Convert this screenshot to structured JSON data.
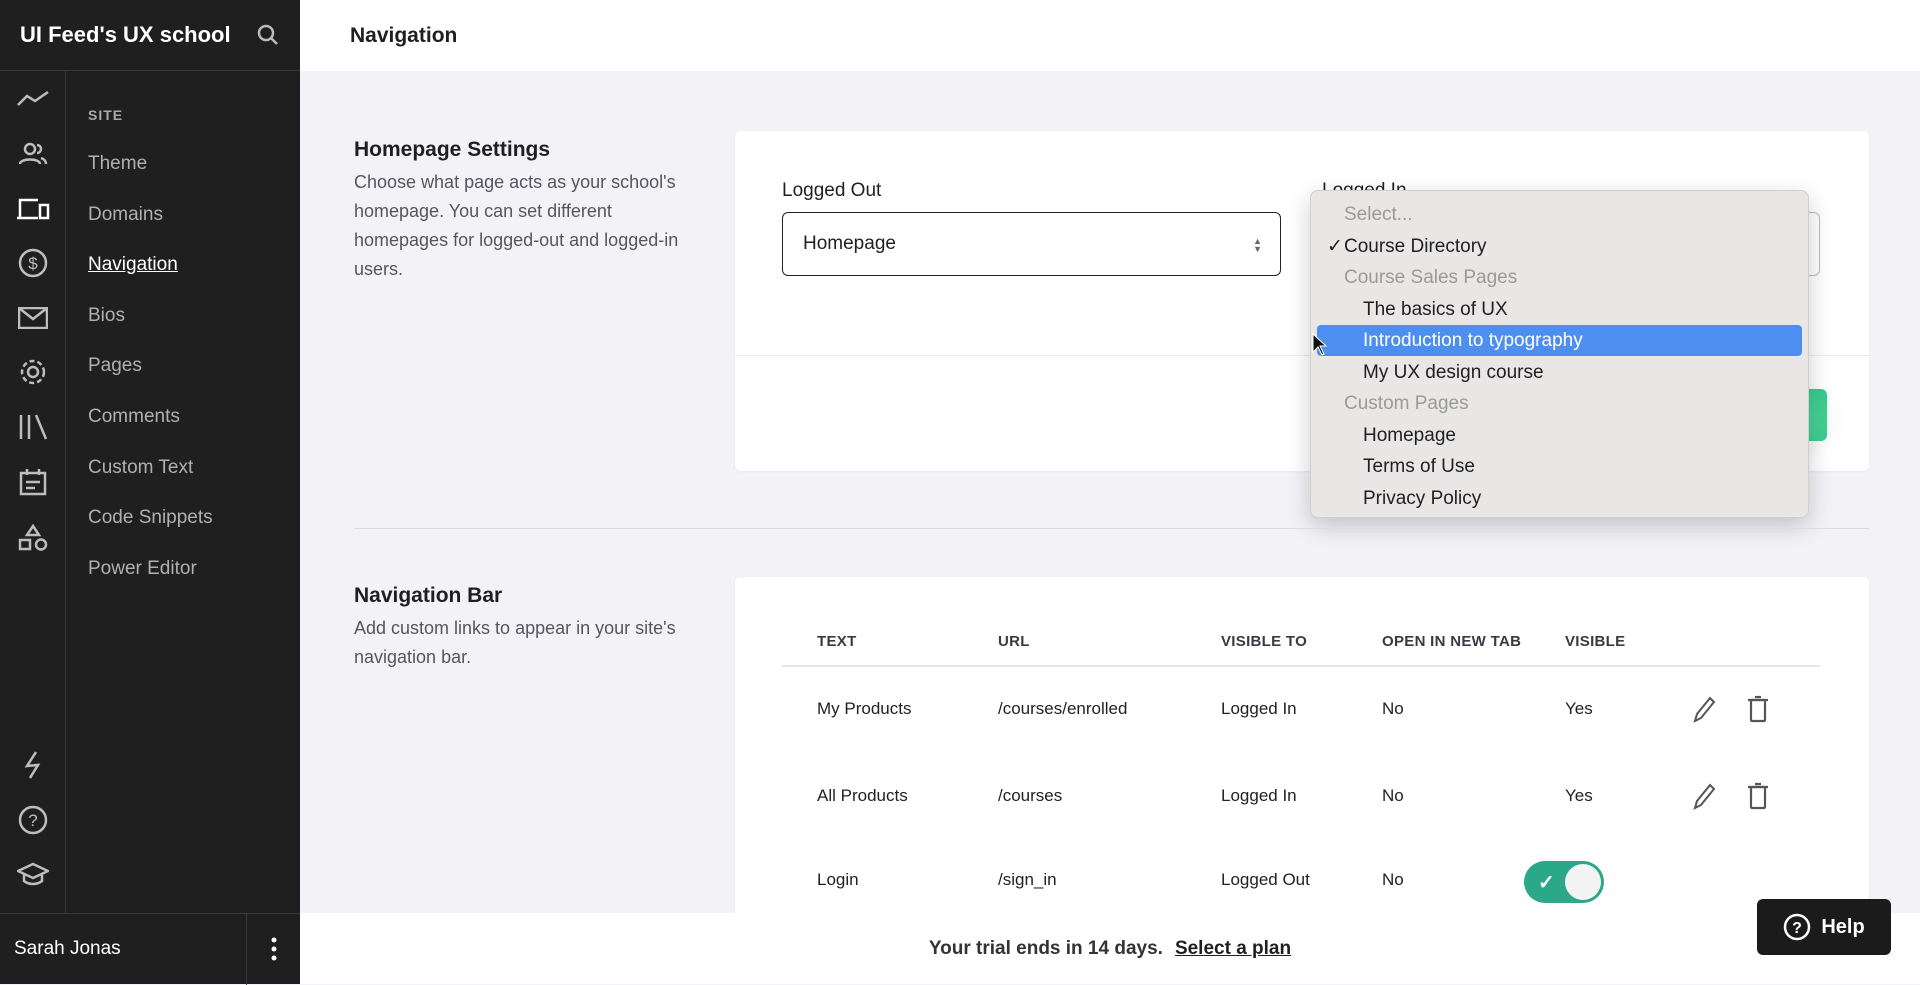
{
  "sidebar": {
    "title": "UI Feed's UX school",
    "section": "SITE",
    "items": [
      "Theme",
      "Domains",
      "Navigation",
      "Bios",
      "Pages",
      "Comments",
      "Custom Text",
      "Code Snippets",
      "Power Editor"
    ],
    "active": "Navigation",
    "icons": [
      "analytics-icon",
      "users-icon",
      "devices-icon",
      "dollar-icon",
      "mail-icon",
      "gear-icon",
      "library-icon",
      "calendar-icon",
      "shapes-icon"
    ],
    "bottom_icons": [
      "lightning-icon",
      "help-icon",
      "graduation-cap-icon"
    ],
    "user": "Sarah Jonas"
  },
  "header": {
    "title": "Navigation"
  },
  "homepage": {
    "title": "Homepage Settings",
    "description": "Choose what page acts as your school's homepage. You can set different homepages for logged-out and logged-in users.",
    "logged_out_label": "Logged Out",
    "logged_out_value": "Homepage",
    "logged_in_label": "Logged In"
  },
  "dropdown": {
    "options": [
      {
        "label": "Select...",
        "type": "placeholder"
      },
      {
        "label": "Course Directory",
        "type": "checked",
        "check": "✓"
      },
      {
        "label": "Course Sales Pages",
        "type": "group"
      },
      {
        "label": "The basics of UX",
        "type": "child"
      },
      {
        "label": "Introduction to typography",
        "type": "highlighted"
      },
      {
        "label": "My UX design course",
        "type": "child"
      },
      {
        "label": "Custom Pages",
        "type": "group"
      },
      {
        "label": "Homepage",
        "type": "child"
      },
      {
        "label": "Terms of Use",
        "type": "child"
      },
      {
        "label": "Privacy Policy",
        "type": "child"
      }
    ],
    "highlight_color": "#4d8ff0"
  },
  "navbar": {
    "title": "Navigation Bar",
    "description": "Add custom links to appear in your site's navigation bar.",
    "columns": [
      "TEXT",
      "URL",
      "VISIBLE TO",
      "OPEN IN NEW TAB",
      "VISIBLE"
    ],
    "rows": [
      {
        "text": "My Products",
        "url": "/courses/enrolled",
        "visible_to": "Logged In",
        "new_tab": "No",
        "visible": "Yes"
      },
      {
        "text": "All Products",
        "url": "/courses",
        "visible_to": "Logged In",
        "new_tab": "No",
        "visible": "Yes"
      },
      {
        "text": "Login",
        "url": "/sign_in",
        "visible_to": "Logged Out",
        "new_tab": "No",
        "visible_toggle": true
      }
    ]
  },
  "footer": {
    "trial": "Your trial ends in 14 days.",
    "link": "Select a plan"
  },
  "help": {
    "label": "Help"
  },
  "colors": {
    "accent": "#2ecc8a",
    "toggle": "#2aa889",
    "sidebar": "#1f1f1f"
  }
}
